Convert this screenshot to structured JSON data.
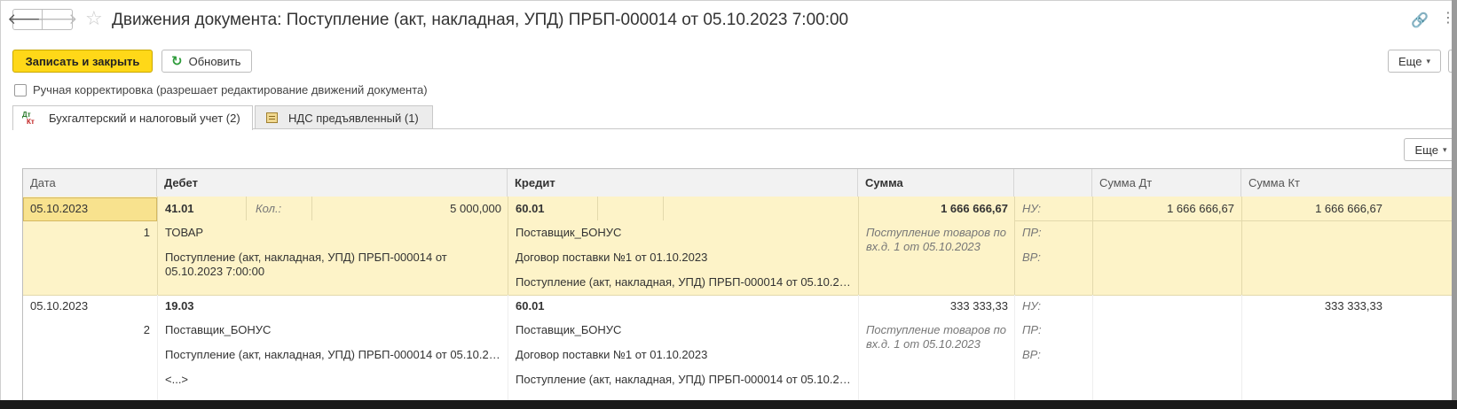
{
  "window": {
    "title": "Движения документа: Поступление (акт, накладная, УПД) ПРБП-000014 от 05.10.2023 7:00:00",
    "back_glyph": "🡐",
    "forward_glyph": "🡒",
    "star_glyph": "☆",
    "link_glyph": "🔗",
    "kebab_glyph": "⋮"
  },
  "toolbar": {
    "save_close_label": "Записать и закрыть",
    "refresh_label": "Обновить",
    "refresh_glyph": "↻",
    "more_label": "Еще",
    "caret": "▾"
  },
  "manual_correction": {
    "label": "Ручная корректировка (разрешает редактирование движений документа)",
    "checked": false
  },
  "tabs": [
    {
      "label": "Бухгалтерский и налоговый учет (2)",
      "icon_dt": "Дт",
      "icon_kt": "Кт",
      "active": true
    },
    {
      "label": "НДС предъявленный (1)",
      "active": false
    }
  ],
  "table": {
    "more_label": "Еще",
    "columns": [
      "Дата",
      "Дебет",
      "Кредит",
      "Сумма",
      "",
      "Сумма Дт",
      "Сумма Кт"
    ],
    "rows": [
      {
        "date": "05.10.2023",
        "number": "1",
        "debit_account": "41.01",
        "qty_label": "Кол.:",
        "qty_value": "5 000,000",
        "debit_sub1": "ТОВАР",
        "debit_sub2": "Поступление (акт, накладная, УПД) ПРБП-000014 от 05.10.2023 7:00:00",
        "credit_account": "60.01",
        "credit_sub1": "Поставщик_БОНУС",
        "credit_sub2": "Договор поставки №1 от 01.10.2023",
        "credit_sub3": "Поступление (акт, накладная, УПД) ПРБП-000014 от 05.10.20…",
        "amount": "1 666 666,67",
        "content": "Поступление товаров по вх.д. 1 от 05.10.2023",
        "nu": "НУ:",
        "pr": "ПР:",
        "vr": "ВР:",
        "amount_dt": "1 666 666,67",
        "amount_kt": "1 666 666,67"
      },
      {
        "date": "05.10.2023",
        "number": "2",
        "debit_account": "19.03",
        "debit_sub1": "Поставщик_БОНУС",
        "debit_sub2": "Поступление (акт, накладная, УПД) ПРБП-000014 от 05.10.20…",
        "debit_sub3": "<...>",
        "credit_account": "60.01",
        "credit_sub1": "Поставщик_БОНУС",
        "credit_sub2": "Договор поставки №1 от 01.10.2023",
        "credit_sub3": "Поступление (акт, накладная, УПД) ПРБП-000014 от 05.10.20…",
        "amount": "333 333,33",
        "content": "Поступление товаров по вх.д. 1 от 05.10.2023",
        "nu": "НУ:",
        "pr": "ПР:",
        "vr": "ВР:",
        "amount_dt": "",
        "amount_kt": "333 333,33"
      }
    ]
  }
}
